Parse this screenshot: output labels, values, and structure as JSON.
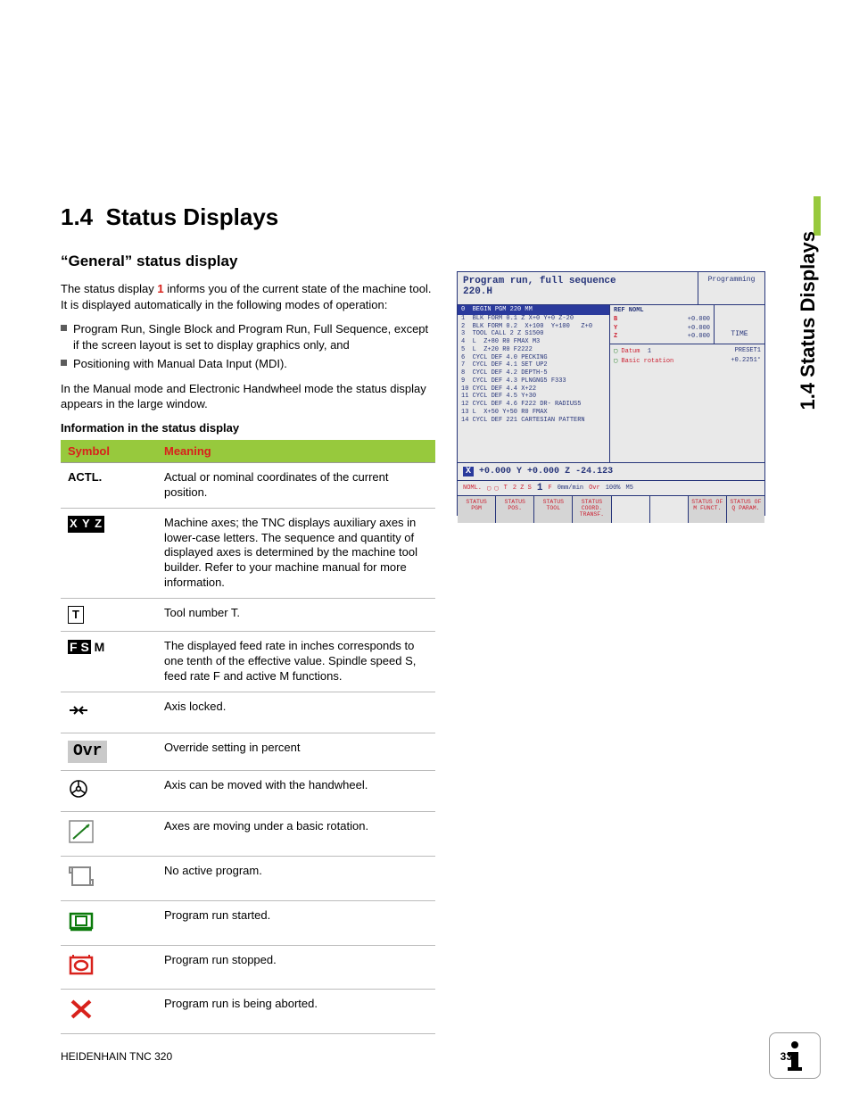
{
  "section_number": "1.4",
  "section_title": "Status Displays",
  "side_tab": "1.4 Status Displays",
  "subsection": "“General” status display",
  "intro_pre": "The status display ",
  "intro_ref": "1",
  "intro_post": " informs you of the current state of the machine tool. It is displayed automatically in the following modes of operation:",
  "bullets": [
    "Program Run, Single Block and Program Run, Full Sequence, except if the screen layout is set to display graphics only, and",
    "Positioning with Manual Data Input (MDI)."
  ],
  "manual_note": "In the Manual mode and Electronic Handwheel mode the status display appears in the large window.",
  "table_caption": "Information in the status display",
  "th_symbol": "Symbol",
  "th_meaning": "Meaning",
  "rows": {
    "actl": {
      "sym": "ACTL.",
      "mean": "Actual or nominal coordinates of the current position."
    },
    "xyz": {
      "sym": "X Y Z",
      "mean": "Machine axes; the TNC displays auxiliary axes in lower-case letters. The sequence and quantity of displayed axes is determined by the machine tool builder. Refer to your machine manual for more information."
    },
    "t": {
      "sym": "T",
      "mean": "Tool number T."
    },
    "fsm": {
      "sym": "FSM",
      "mean": "The displayed feed rate in inches corresponds to one tenth of the effective value. Spindle speed S, feed rate F and active M functions."
    },
    "lock": {
      "mean": "Axis locked."
    },
    "ovr": {
      "sym": "Ovr",
      "mean": "Override setting in percent"
    },
    "hw": {
      "mean": "Axis can be moved with the handwheel."
    },
    "rot": {
      "mean": "Axes are moving under a basic rotation."
    },
    "np": {
      "mean": "No active program."
    },
    "start": {
      "mean": "Program run started."
    },
    "stop": {
      "mean": "Program run stopped."
    },
    "abort": {
      "mean": "Program run is being aborted."
    }
  },
  "screenshot": {
    "title": "Program run, full sequence",
    "file": "220.H",
    "mode": "Programming",
    "time_label": "TIME",
    "program_header": "BEGIN PGM 220 MM",
    "lines": [
      "1  BLK FORM 0.1 Z X+0 Y+0 Z-20",
      "2  BLK FORM 0.2  X+100  Y+100   Z+0",
      "3  TOOL CALL 2 Z S1500",
      "4  L  Z+80 R0 FMAX M3",
      "5  L  Z+20 R0 F2222",
      "6  CYCL DEF 4.0 PECKING",
      "7  CYCL DEF 4.1 SET UP2",
      "8  CYCL DEF 4.2 DEPTH-5",
      "9  CYCL DEF 4.3 PLNGNG5 F333",
      "10 CYCL DEF 4.4 X+22",
      "11 CYCL DEF 4.5 Y+30",
      "12 CYCL DEF 4.6 F222 DR- RADIUS5",
      "13 L  X+50 Y+50 R0 FMAX",
      "14 CYCL DEF 221 CARTESIAN PATTERN"
    ],
    "ref_noml": "REF NOML",
    "ref_vals": {
      "B": "+0.000",
      "Y": "+0.000",
      "Z": "+0.000"
    },
    "datum_label": "Datum",
    "datum_val": "1",
    "preset": "PRESET1",
    "rot_label": "Basic rotation",
    "rot_val": "+0.2251°",
    "coords": {
      "X": "+0.000",
      "Y": "+0.000",
      "Z": "-24.123"
    },
    "statline": {
      "mode": "NOML.",
      "t": "T",
      "tval": "2  Z  S",
      "one": "1",
      "f": "F",
      "fr": "0mm/min",
      "ovr": "Ovr",
      "ovrv": "100%",
      "m": "M5"
    },
    "softkeys": [
      "STATUS\nPGM",
      "STATUS\nPOS.",
      "STATUS\nTOOL",
      "STATUS\nCOORD.\nTRANSF.",
      "",
      "",
      "STATUS OF\nM FUNCT.",
      "STATUS OF\nQ PARAM."
    ]
  },
  "footer_left": "HEIDENHAIN TNC 320",
  "footer_page": "33"
}
